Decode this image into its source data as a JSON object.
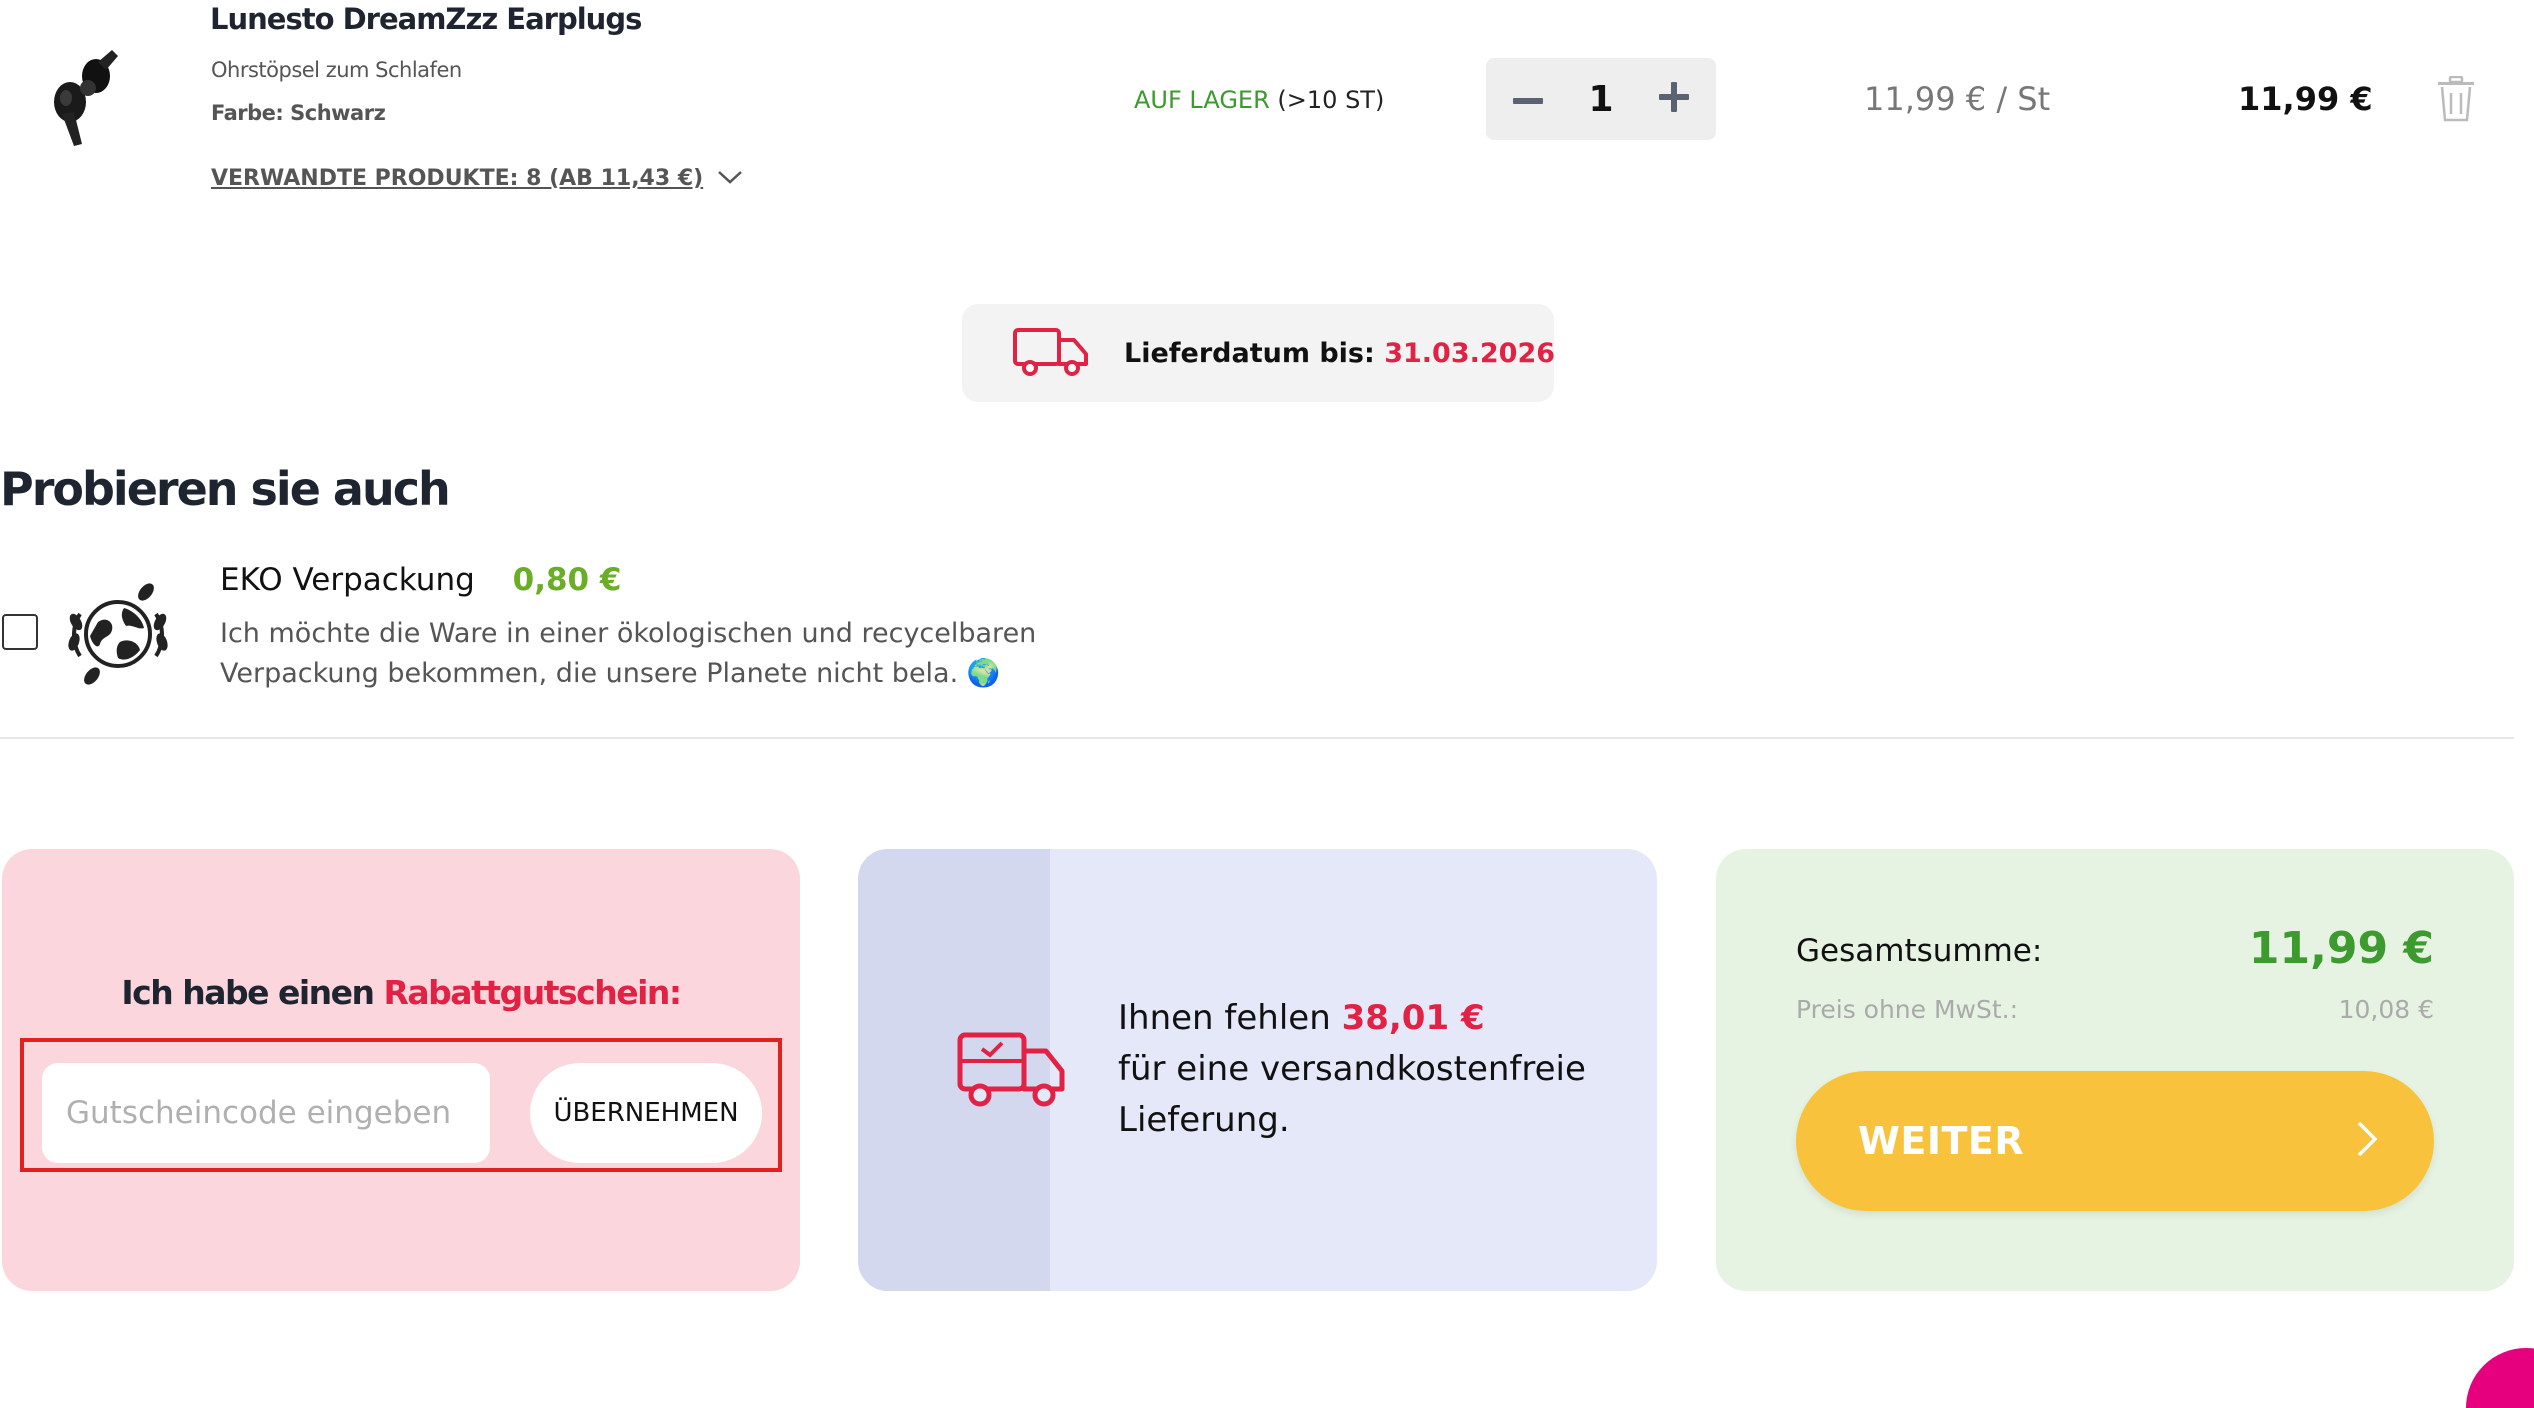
{
  "product": {
    "name": "Lunesto DreamZzz Earplugs",
    "subtitle": "Ohrstöpsel zum Schlafen",
    "color_label": "Farbe: Schwarz",
    "related_link": "VERWANDTE PRODUKTE: 8 (AB 11,43 €)",
    "stock_status": "AUF LAGER",
    "stock_count": "(>10 ST)",
    "quantity": "1",
    "unit_price": "11,99 €  / St",
    "line_total": "11,99 €",
    "icons": [
      "earplug-product-image",
      "chevron-down-icon",
      "minus-icon",
      "plus-icon",
      "trash-icon"
    ]
  },
  "delivery": {
    "label": "Lieferdatum bis:",
    "date": "31.03.2026",
    "icon": "delivery-truck-icon"
  },
  "suggestions": {
    "title": "Probieren sie auch",
    "eko": {
      "name": "EKO Verpackung",
      "price": "0,80 €",
      "description": "Ich möchte die Ware in einer ökologischen und recycelbaren Verpackung bekommen, die unsere Planete nicht bela. 🌍",
      "checked": false,
      "icon": "eco-globe-icon"
    }
  },
  "voucher": {
    "title_prefix": "Ich habe einen ",
    "title_highlight": "Rabattgutschein",
    "title_suffix": ":",
    "input_placeholder": "Gutscheincode eingeben",
    "input_value": "",
    "apply_button": "ÜBERNEHMEN"
  },
  "shipping": {
    "line1_prefix": "Ihnen fehlen ",
    "missing_amount": "38,01 €",
    "line2": "für eine versandkostenfreie",
    "line3": "Lieferung.",
    "icon": "delivery-van-check-icon"
  },
  "summary": {
    "total_label": "Gesamtsumme:",
    "total_value": "11,99 €",
    "net_label": "Preis ohne MwSt.:",
    "net_value": "10,08 €",
    "continue_button": "WEITER",
    "continue_icon": "chevron-right-icon"
  },
  "colors": {
    "accent_red": "#e22245",
    "green": "#3c9a2e",
    "button_yellow": "#f9c23c",
    "voucher_bg": "#fbd7dd",
    "shipping_bg": "#e5e8f8",
    "total_bg": "#e6f3e2"
  }
}
